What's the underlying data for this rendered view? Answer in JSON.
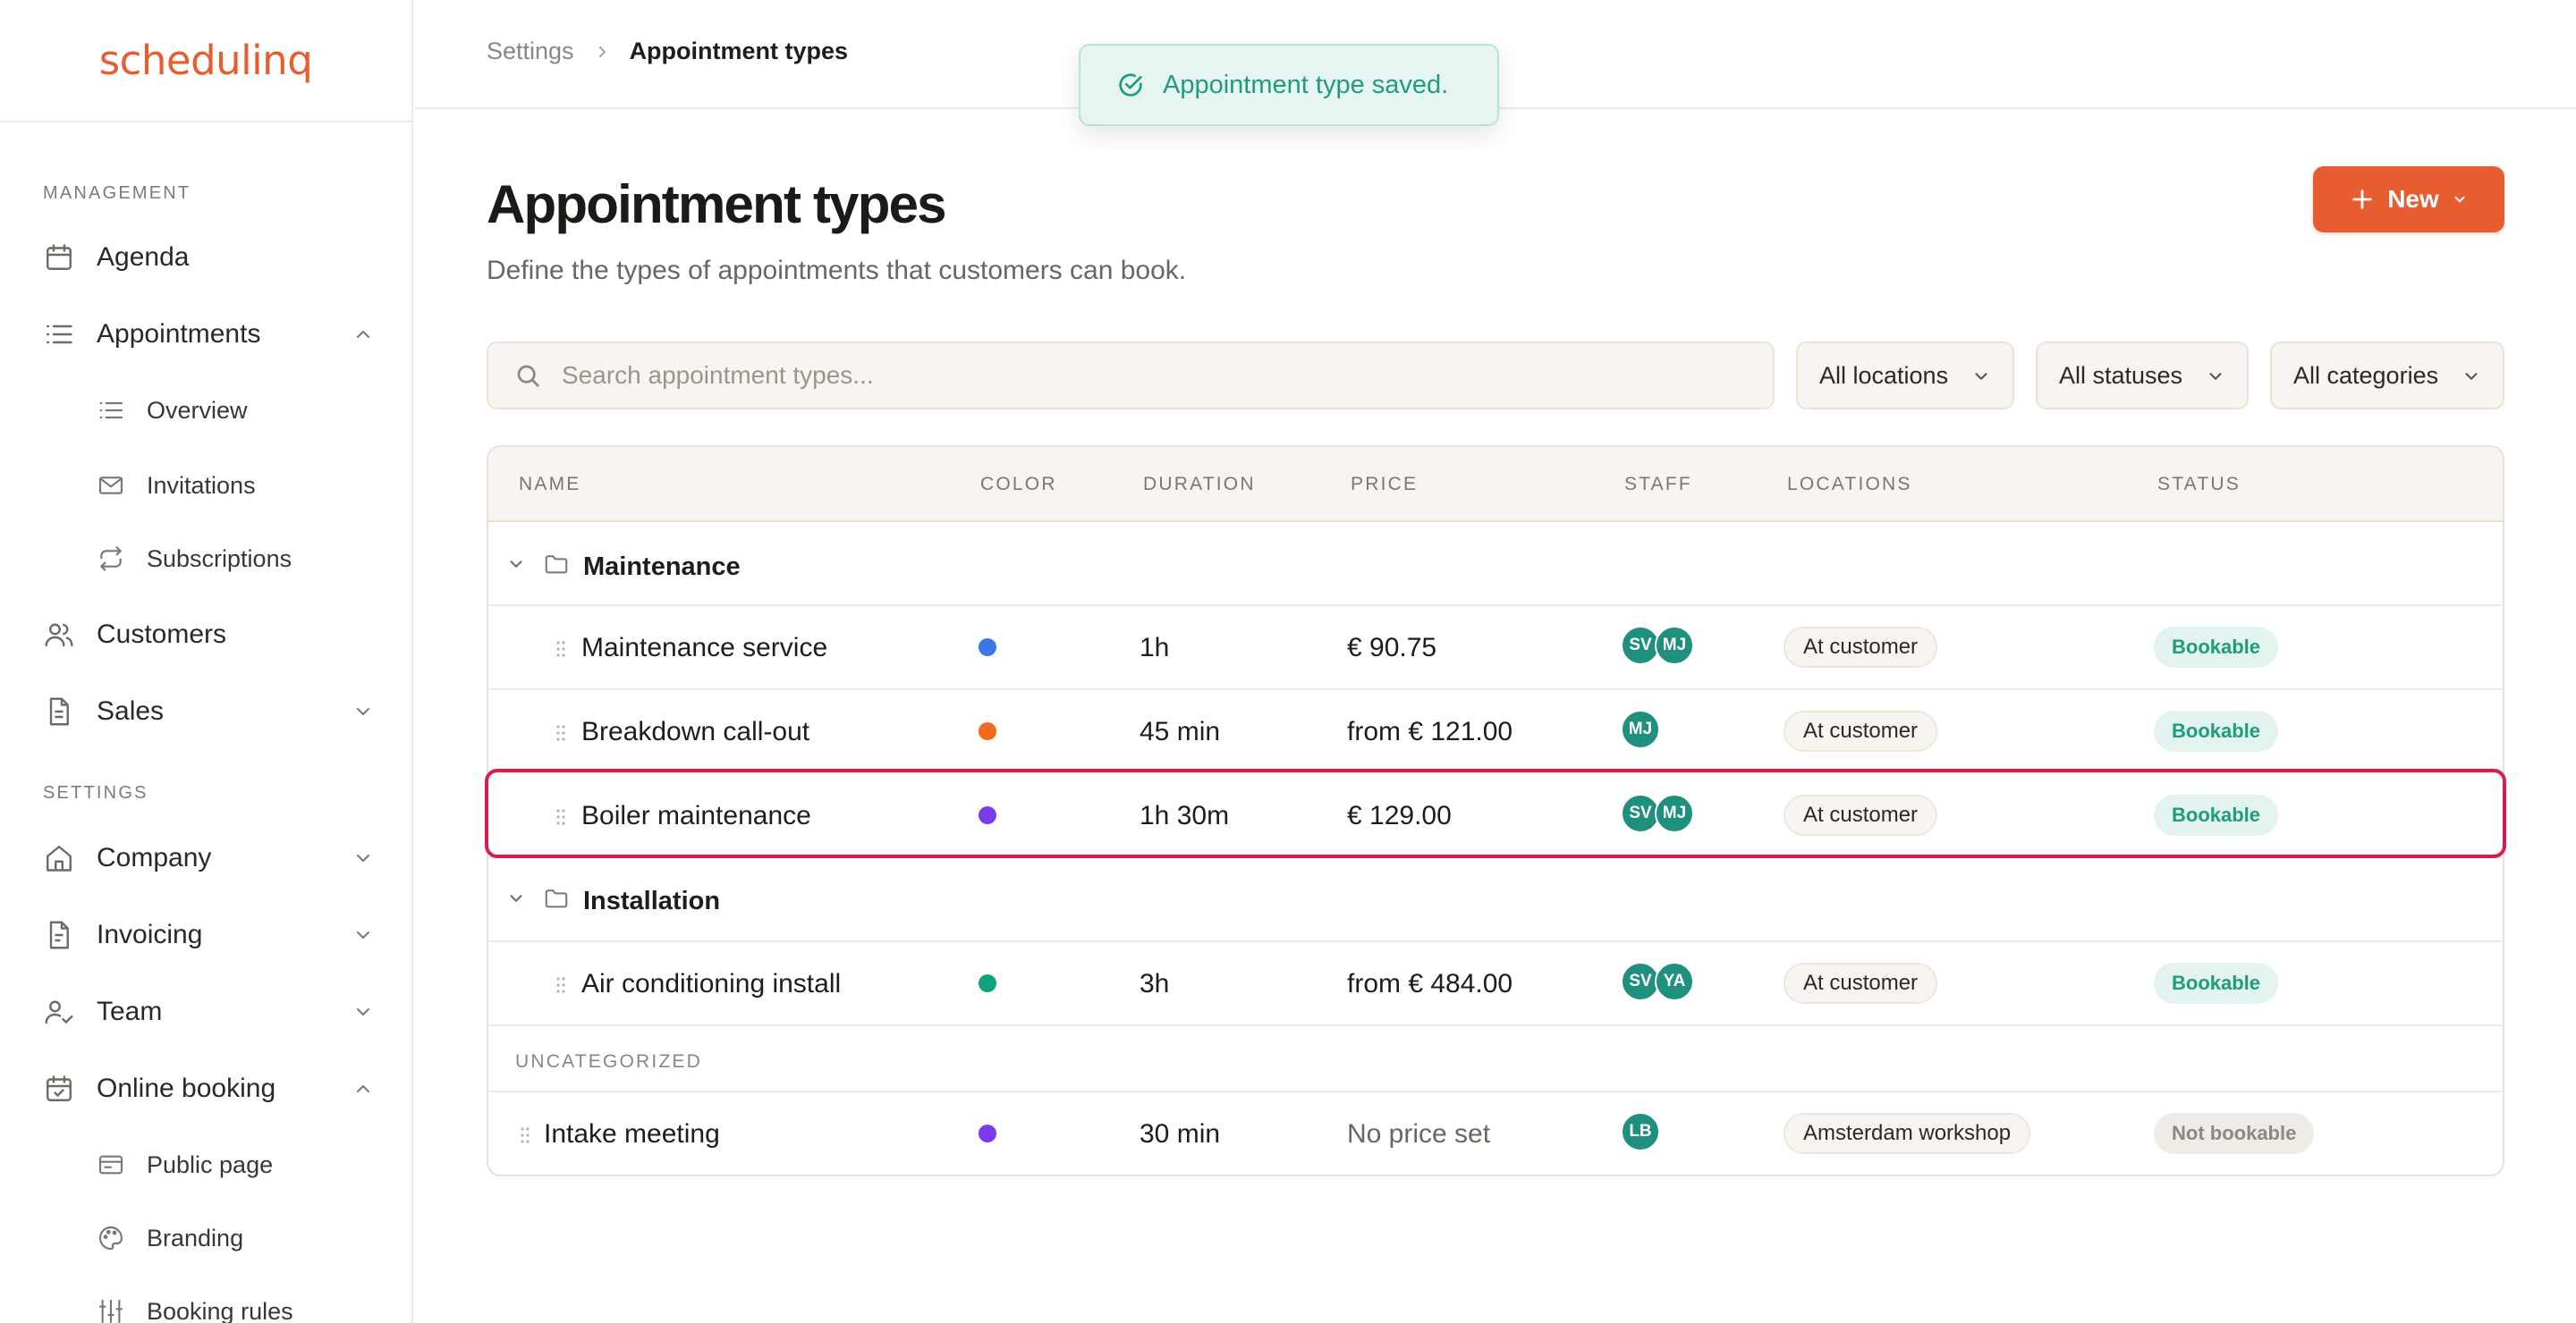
{
  "app": {
    "logo_text": "schedulinq",
    "brand_color": "#e85d2f"
  },
  "sidebar": {
    "management_label": "MANAGEMENT",
    "settings_label": "SETTINGS",
    "items": {
      "agenda": "Agenda",
      "appointments": "Appointments",
      "overview": "Overview",
      "invitations": "Invitations",
      "subscriptions": "Subscriptions",
      "customers": "Customers",
      "sales": "Sales",
      "company": "Company",
      "invoicing": "Invoicing",
      "team": "Team",
      "online_booking": "Online booking",
      "public_page": "Public page",
      "branding": "Branding",
      "booking_rules": "Booking rules"
    }
  },
  "breadcrumb": {
    "parent": "Settings",
    "current": "Appointment types"
  },
  "toast": {
    "message": "Appointment type saved.",
    "icon": "check-circle-icon"
  },
  "header": {
    "title": "Appointment types",
    "description": "Define the types of appointments that customers can book.",
    "new_button": "New"
  },
  "filters": {
    "search_placeholder": "Search appointment types...",
    "locations": "All locations",
    "statuses": "All statuses",
    "categories": "All categories"
  },
  "table": {
    "columns": {
      "name": "NAME",
      "color": "COLOR",
      "duration": "DURATION",
      "price": "PRICE",
      "staff": "STAFF",
      "locations": "LOCATIONS",
      "status": "STATUS"
    },
    "groups": {
      "maintenance": "Maintenance",
      "installation": "Installation",
      "uncategorized": "UNCATEGORIZED"
    },
    "rows": [
      {
        "name": "Maintenance service",
        "color": "#3b78e7",
        "duration": "1h",
        "price": "€ 90.75",
        "staff": [
          "SV",
          "MJ"
        ],
        "location": "At customer",
        "status": "Bookable"
      },
      {
        "name": "Breakdown call-out",
        "color": "#f06a1a",
        "duration": "45 min",
        "price": "from € 121.00",
        "staff": [
          "MJ"
        ],
        "location": "At customer",
        "status": "Bookable"
      },
      {
        "name": "Boiler maintenance",
        "color": "#7c3aed",
        "duration": "1h 30m",
        "price": "€ 129.00",
        "staff": [
          "SV",
          "MJ"
        ],
        "location": "At customer",
        "status": "Bookable",
        "selected": true
      },
      {
        "name": "Air conditioning install",
        "color": "#10a37f",
        "duration": "3h",
        "price": "from € 484.00",
        "staff": [
          "SV",
          "YA"
        ],
        "location": "At customer",
        "status": "Bookable"
      },
      {
        "name": "Intake meeting",
        "color": "#7c3aed",
        "duration": "30 min",
        "price": "No price set",
        "staff": [
          "LB"
        ],
        "location": "Amsterdam workshop",
        "status": "Not bookable"
      }
    ]
  }
}
